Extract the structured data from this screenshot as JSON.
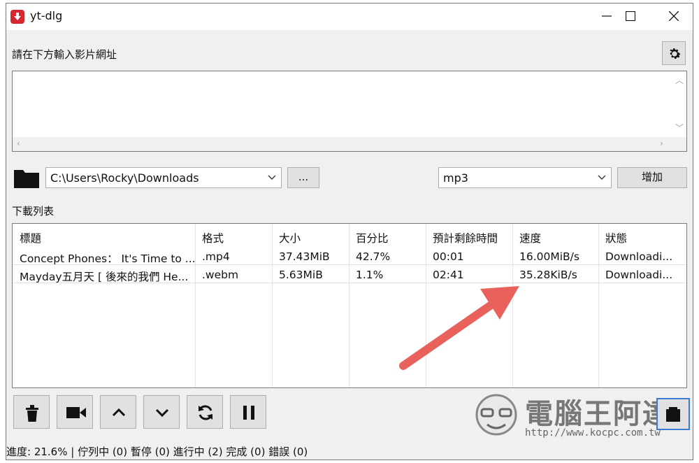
{
  "window": {
    "title": "yt-dlg"
  },
  "url_section": {
    "label": "請在下方輸入影片網址",
    "value": ""
  },
  "path": {
    "value": "C:\\Users\\Rocky\\Downloads",
    "browse_label": "..."
  },
  "format": {
    "value": "mp3"
  },
  "add_label": "增加",
  "list": {
    "label": "下載列表",
    "columns": [
      "標題",
      "格式",
      "大小",
      "百分比",
      "預計剩餘時間",
      "速度",
      "狀態"
    ],
    "rows": [
      [
        "Concept Phones： It's Time to ...",
        ".mp4",
        "37.43MiB",
        "42.7%",
        "00:01",
        "16.00MiB/s",
        "Downloadi..."
      ],
      [
        "Mayday五月天 [ 後來的我們 He...",
        ".webm",
        "5.63MiB",
        "1.1%",
        "02:41",
        "35.28KiB/s",
        "Downloadi..."
      ]
    ]
  },
  "watermark": {
    "title": "電腦王阿達",
    "url": "http://www.kocpc.com.tw"
  },
  "status": "進度: 21.6% | 佇列中 (0) 暫停 (0) 進行中 (2) 完成 (0) 錯誤 (0)",
  "colors": {
    "accent_arrow": "#e8625b",
    "app_icon": "#d6262f",
    "focus_border": "#3a7bd5"
  },
  "icons": [
    "download-icon",
    "gear-icon",
    "folder-icon",
    "trash-icon",
    "video-camera-icon",
    "chevron-up-icon",
    "chevron-down-icon",
    "refresh-icon",
    "pause-icon",
    "panel-icon"
  ]
}
